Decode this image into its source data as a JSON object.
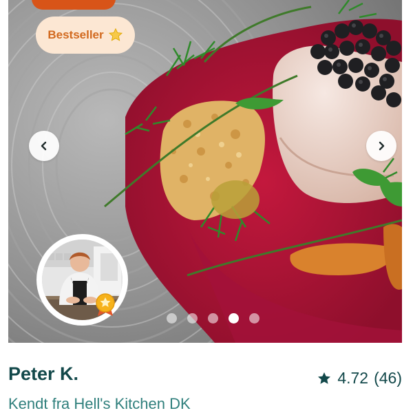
{
  "card": {
    "badge": {
      "label": "Bestseller",
      "icon": "star-icon"
    },
    "carousel": {
      "slide_count": 5,
      "active_index": 3
    },
    "chef": {
      "name": "Peter K.",
      "subtitle": "Kendt fra Hell's Kitchen DK"
    },
    "rating": {
      "value": "4.72",
      "count": "(46)"
    }
  },
  "colors": {
    "primary_text": "#12484a",
    "secondary_text": "#2f7f7c",
    "badge_bg": "#fce7d3",
    "badge_text": "#d2691e",
    "accent_orange": "#d85418"
  }
}
